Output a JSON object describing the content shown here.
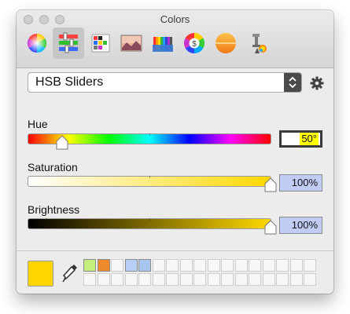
{
  "window": {
    "title": "Colors"
  },
  "toolbar": {
    "tools": [
      {
        "name": "color-wheel-icon",
        "active": false
      },
      {
        "name": "color-sliders-icon",
        "active": true
      },
      {
        "name": "color-palettes-icon",
        "active": false
      },
      {
        "name": "image-palettes-icon",
        "active": false
      },
      {
        "name": "pencils-icon",
        "active": false
      },
      {
        "name": "spectrum-icon",
        "active": false
      },
      {
        "name": "crayon-circle-icon",
        "active": false
      },
      {
        "name": "paint-tool-icon",
        "active": false
      }
    ]
  },
  "mode_popup": {
    "selected": "HSB Sliders"
  },
  "sliders": {
    "hue": {
      "label": "Hue",
      "value": 50,
      "display": "50°",
      "max": 360
    },
    "saturation": {
      "label": "Saturation",
      "value": 100,
      "display": "100%",
      "max": 100
    },
    "brightness": {
      "label": "Brightness",
      "value": 100,
      "display": "100%",
      "max": 100
    }
  },
  "current_color": "#ffd400",
  "swatches": {
    "filled": [
      {
        "row": 0,
        "col": 0,
        "color": "#c6ee7e"
      },
      {
        "row": 0,
        "col": 1,
        "color": "#ee8a2c"
      },
      {
        "row": 0,
        "col": 3,
        "color": "#b8cff5"
      },
      {
        "row": 0,
        "col": 4,
        "color": "#a9c6ef"
      }
    ]
  }
}
